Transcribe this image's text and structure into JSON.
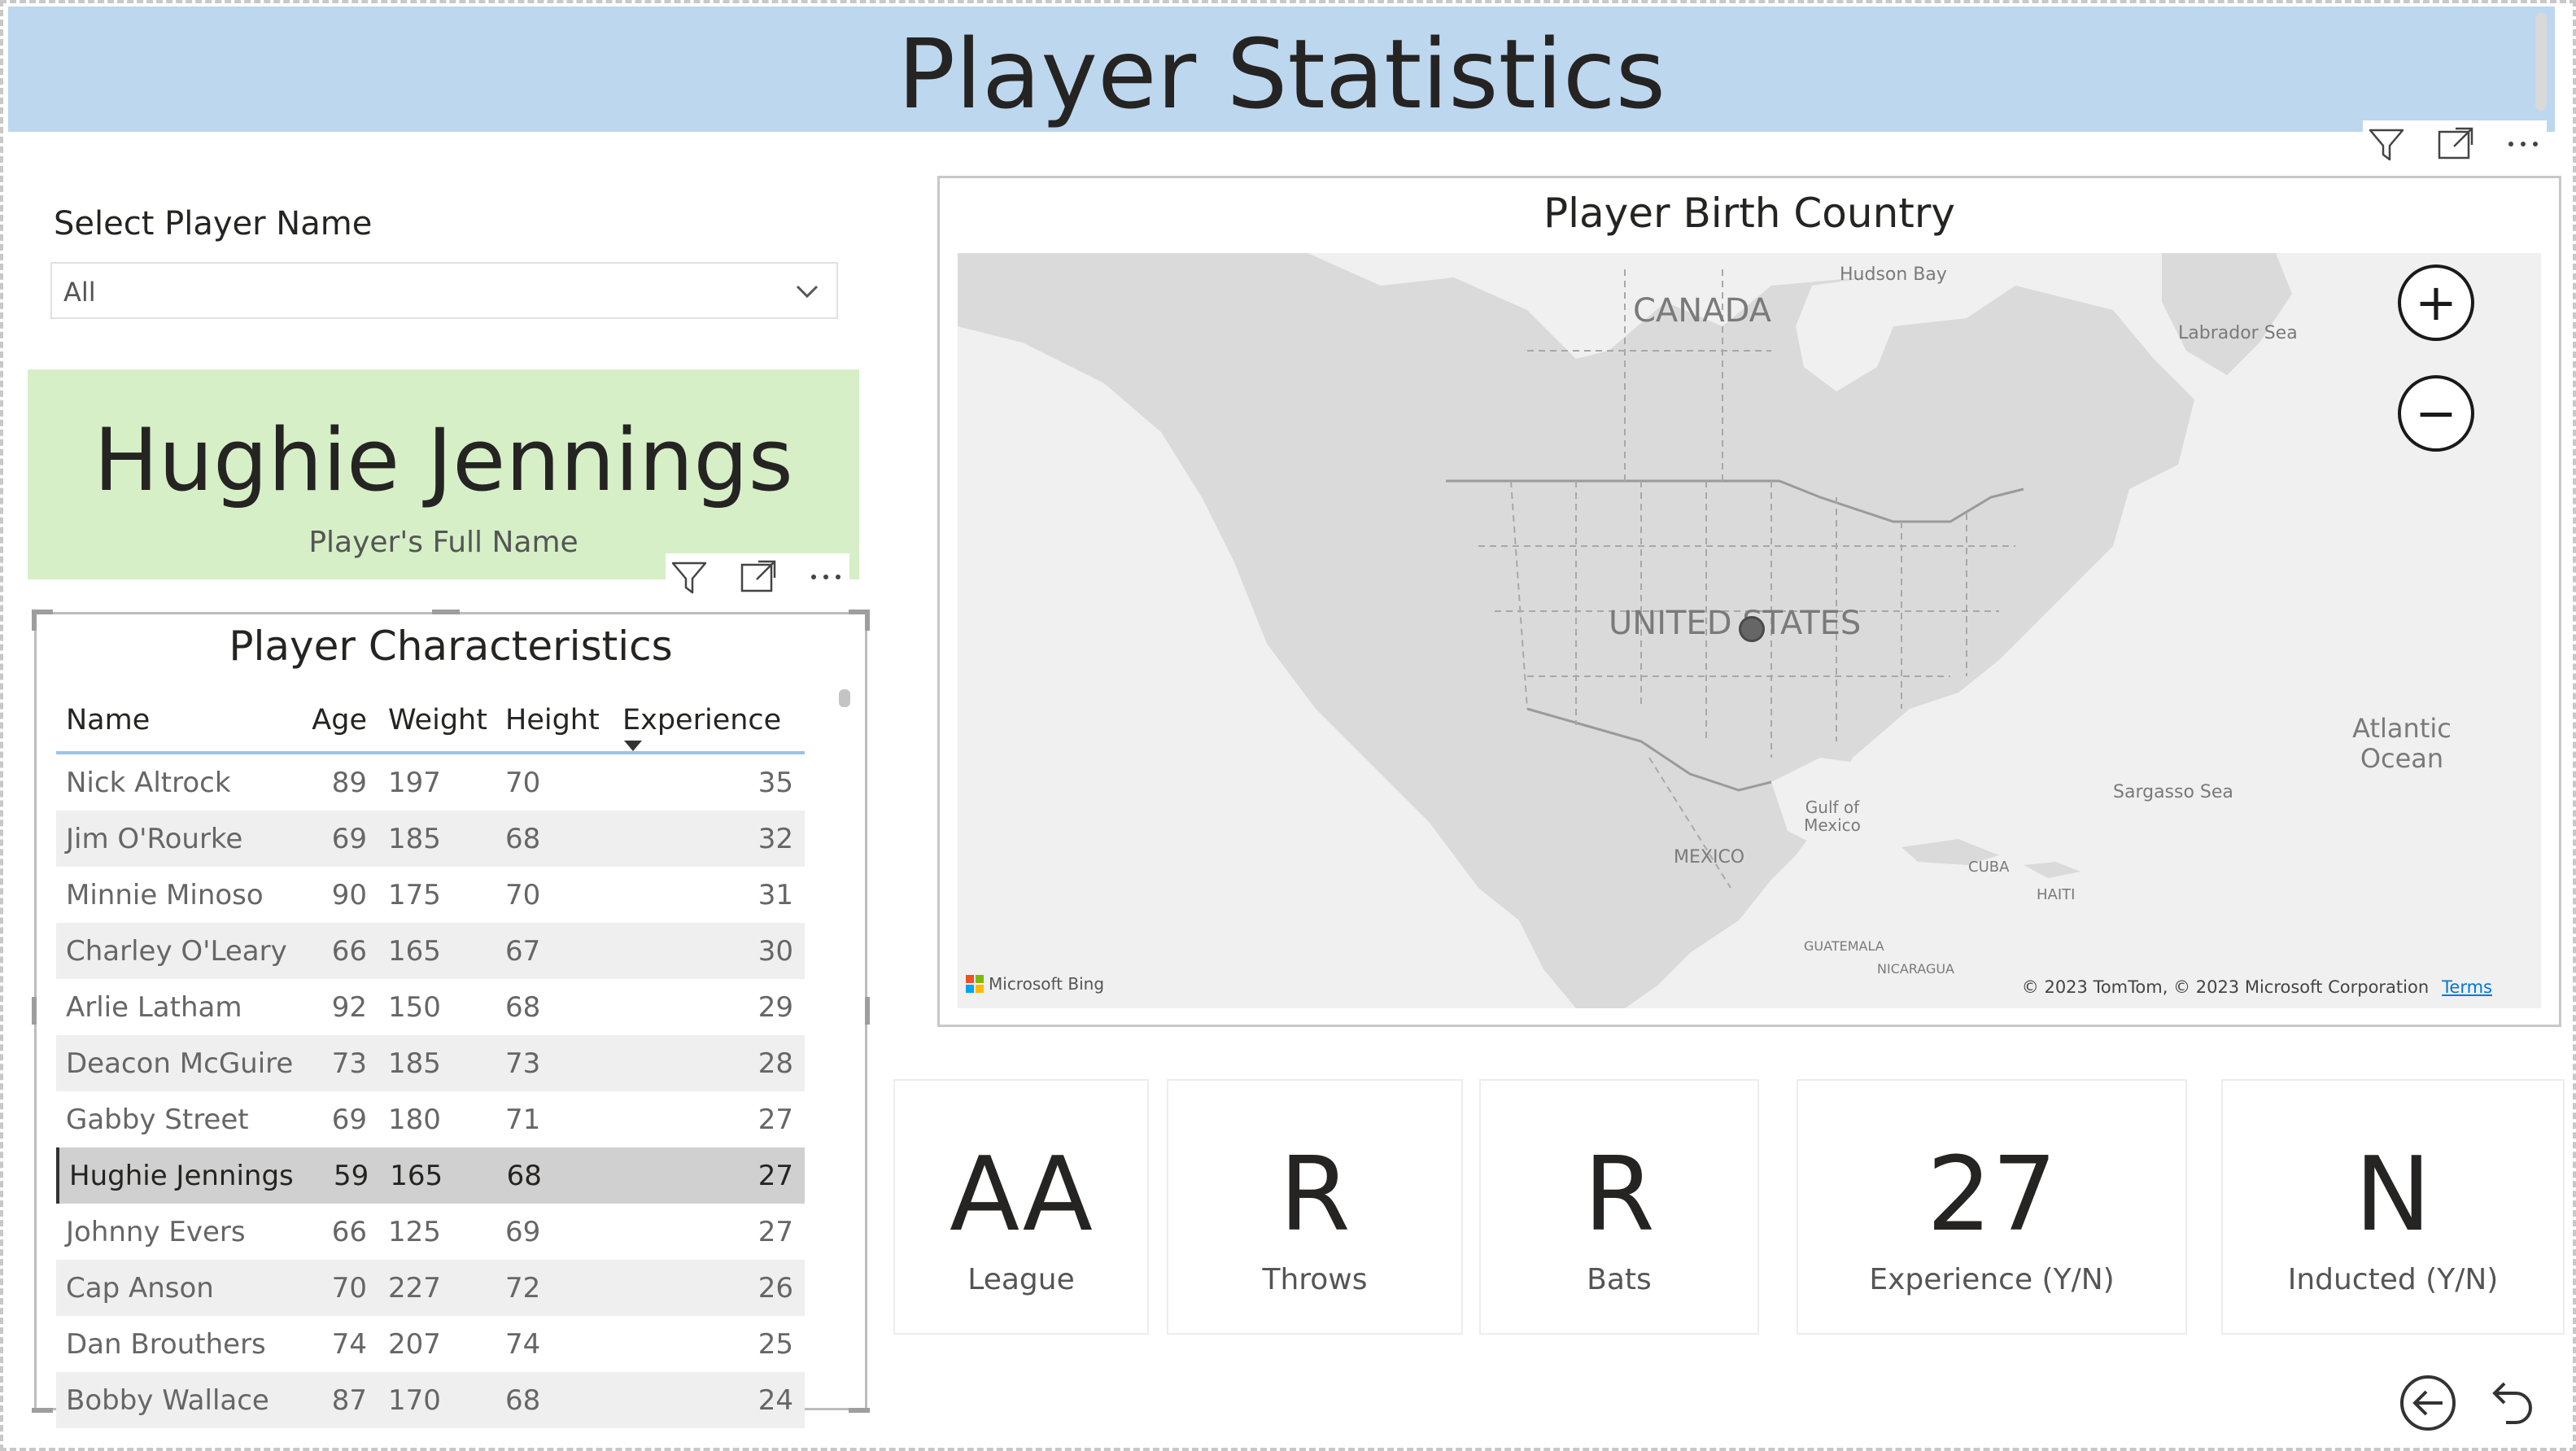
{
  "header": {
    "title": "Player Statistics"
  },
  "slicer": {
    "label": "Select Player Name",
    "value": "All"
  },
  "name_card": {
    "value": "Hughie Jennings",
    "label": "Player's Full Name"
  },
  "table": {
    "title": "Player Characteristics",
    "columns": [
      "Name",
      "Age",
      "Weight",
      "Height",
      "Experience"
    ],
    "sorted_column": "Experience",
    "rows": [
      {
        "name": "Nick Altrock",
        "age": "89",
        "weight": "197",
        "height": "70",
        "experience": "35"
      },
      {
        "name": "Jim O'Rourke",
        "age": "69",
        "weight": "185",
        "height": "68",
        "experience": "32"
      },
      {
        "name": "Minnie Minoso",
        "age": "90",
        "weight": "175",
        "height": "70",
        "experience": "31"
      },
      {
        "name": "Charley O'Leary",
        "age": "66",
        "weight": "165",
        "height": "67",
        "experience": "30"
      },
      {
        "name": "Arlie Latham",
        "age": "92",
        "weight": "150",
        "height": "68",
        "experience": "29"
      },
      {
        "name": "Deacon McGuire",
        "age": "73",
        "weight": "185",
        "height": "73",
        "experience": "28"
      },
      {
        "name": "Gabby Street",
        "age": "69",
        "weight": "180",
        "height": "71",
        "experience": "27"
      },
      {
        "name": "Hughie Jennings",
        "age": "59",
        "weight": "165",
        "height": "68",
        "experience": "27",
        "selected": true
      },
      {
        "name": "Johnny Evers",
        "age": "66",
        "weight": "125",
        "height": "69",
        "experience": "27"
      },
      {
        "name": "Cap Anson",
        "age": "70",
        "weight": "227",
        "height": "72",
        "experience": "26"
      },
      {
        "name": "Dan Brouthers",
        "age": "74",
        "weight": "207",
        "height": "74",
        "experience": "25"
      },
      {
        "name": "Bobby Wallace",
        "age": "87",
        "weight": "170",
        "height": "68",
        "experience": "24"
      }
    ]
  },
  "map": {
    "title": "Player Birth Country",
    "labels": {
      "canada": "CANADA",
      "united_states": "UNITED STATES",
      "mexico": "MEXICO",
      "hudson_bay": "Hudson Bay",
      "labrador_sea": "Labrador Sea",
      "atlantic_ocean": "Atlantic Ocean",
      "sargasso_sea": "Sargasso Sea",
      "gulf_of_mexico": "Gulf of Mexico",
      "cuba": "CUBA",
      "haiti": "HAITI",
      "guatemala": "GUATEMALA",
      "nicaragua": "NICARAGUA"
    },
    "zoom_in": "+",
    "zoom_out": "−",
    "bing_label": "Microsoft Bing",
    "attribution": "© 2023 TomTom, © 2023 Microsoft Corporation",
    "terms": "Terms"
  },
  "kpis": [
    {
      "value": "AA",
      "label": "League"
    },
    {
      "value": "R",
      "label": "Throws"
    },
    {
      "value": "R",
      "label": "Bats"
    },
    {
      "value": "27",
      "label": "Experience (Y/N)"
    },
    {
      "value": "N",
      "label": "Inducted (Y/N)"
    }
  ],
  "icons": {
    "filter": "filter-icon",
    "focus": "focus-mode-icon",
    "more": "more-options-icon",
    "back": "back-arrow-icon",
    "reset": "reset-icon"
  },
  "colors": {
    "header_bg": "#bdd7ee",
    "name_card_bg": "#d6efc7",
    "table_header_border": "#9cc3e8",
    "selected_row": "#d0d0d0",
    "map_land": "#dadada",
    "map_water": "#f0f0f0"
  }
}
